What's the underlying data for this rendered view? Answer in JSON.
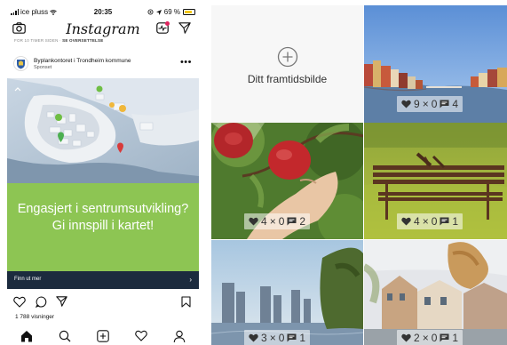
{
  "status": {
    "carrier": "ice pluss",
    "time": "20:35",
    "battery": "69 %"
  },
  "topbar": {
    "logo": "Instagram"
  },
  "notice": {
    "prefix": "FOR 10 TIMER SIDEN",
    "separator": " · ",
    "action": "SE OVERSETTELSE"
  },
  "post": {
    "account": "Byplankontoret i Trondheim kommune",
    "sponsored": "Sponset",
    "more": "•••",
    "ad_title": "Engasjert i sentrumsutvikling? Gi innspill i kartet!",
    "cta": "Finn ut mer",
    "views": "1 788 visninger"
  },
  "grid": {
    "placeholder_label": "Ditt framtidsbilde",
    "tiles": [
      {
        "name": "river",
        "likes": "9",
        "shares": "0",
        "comments": "4"
      },
      {
        "name": "apple",
        "likes": "4",
        "shares": "0",
        "comments": "2"
      },
      {
        "name": "bench",
        "likes": "4",
        "shares": "0",
        "comments": "1"
      },
      {
        "name": "city",
        "likes": "3",
        "shares": "0",
        "comments": "1"
      },
      {
        "name": "houses",
        "likes": "2",
        "shares": "0",
        "comments": "1"
      }
    ]
  },
  "colors": {
    "ad_green": "#8dc553",
    "cta_navy": "#1c2b3e",
    "notification": "#e0245e",
    "battery": "#f5c518"
  },
  "icons": {
    "status": [
      "signal-icon",
      "wifi-icon",
      "location-icon",
      "battery-icon"
    ],
    "topbar": [
      "camera-icon",
      "activity-icon",
      "direct-message-icon"
    ],
    "actions": [
      "heart-icon",
      "comment-icon",
      "share-icon",
      "bookmark-icon"
    ],
    "nav": [
      "home-icon",
      "search-icon",
      "add-post-icon",
      "activity-icon",
      "profile-icon"
    ],
    "stats": [
      "heart-icon",
      "close-icon",
      "comment-icon"
    ]
  }
}
